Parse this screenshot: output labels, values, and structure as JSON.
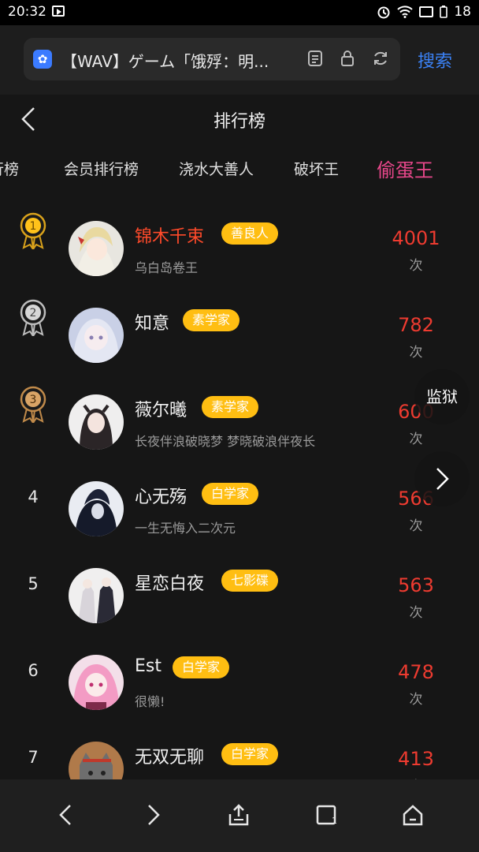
{
  "status": {
    "time": "20:32",
    "battery": "18"
  },
  "browser": {
    "tab_title": "【WAV】ゲーム「饿殍：明...",
    "search_label": "搜索"
  },
  "page": {
    "title": "排行榜"
  },
  "tabs": [
    {
      "label": "行榜"
    },
    {
      "label": "会员排行榜"
    },
    {
      "label": "浇水大善人"
    },
    {
      "label": "破坏王"
    },
    {
      "label": "偷蛋王"
    }
  ],
  "ranking": [
    {
      "rank": "1",
      "name": "锦木千束",
      "badge": "善良人",
      "signature": "乌白岛卷王",
      "count": "4001",
      "unit": "次"
    },
    {
      "rank": "2",
      "name": "知意",
      "badge": "素学家",
      "signature": "",
      "count": "782",
      "unit": "次"
    },
    {
      "rank": "3",
      "name": "薇尔曦",
      "badge": "素学家",
      "signature": "长夜伴浪破晓梦 梦晓破浪伴夜长",
      "count": "600",
      "unit": "次"
    },
    {
      "rank": "4",
      "name": "心无殇",
      "badge": "白学家",
      "signature": "一生无悔入二次元",
      "count": "566",
      "unit": "次"
    },
    {
      "rank": "5",
      "name": "星恋白夜",
      "badge": "七影碟",
      "signature": "",
      "count": "563",
      "unit": "次"
    },
    {
      "rank": "6",
      "name": "Est",
      "badge": "白学家",
      "signature": "很懒!",
      "count": "478",
      "unit": "次"
    },
    {
      "rank": "7",
      "name": "无双无聊",
      "badge": "白学家",
      "signature": "",
      "count": "413",
      "unit": "次"
    }
  ],
  "floating": {
    "jail_label": "监狱"
  },
  "colors": {
    "accent_tab": "#e8478b",
    "count": "#ee3b30",
    "badge": "#ffbe12",
    "highlight_name": "#ff4a2a",
    "link": "#3b82f6"
  }
}
